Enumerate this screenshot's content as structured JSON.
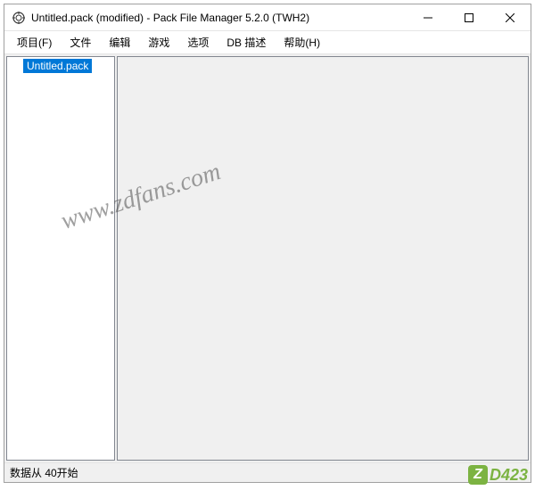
{
  "titlebar": {
    "title": "Untitled.pack (modified) - Pack File Manager 5.2.0 (TWH2)"
  },
  "menubar": {
    "items": [
      "项目(F)",
      "文件",
      "编辑",
      "游戏",
      "选项",
      "DB 描述",
      "帮助(H)"
    ]
  },
  "tree": {
    "root": "Untitled.pack"
  },
  "statusbar": {
    "text": "数据从 40开始"
  },
  "watermark": "www.zdfans.com",
  "badge": {
    "z": "Z",
    "text": "D423"
  }
}
